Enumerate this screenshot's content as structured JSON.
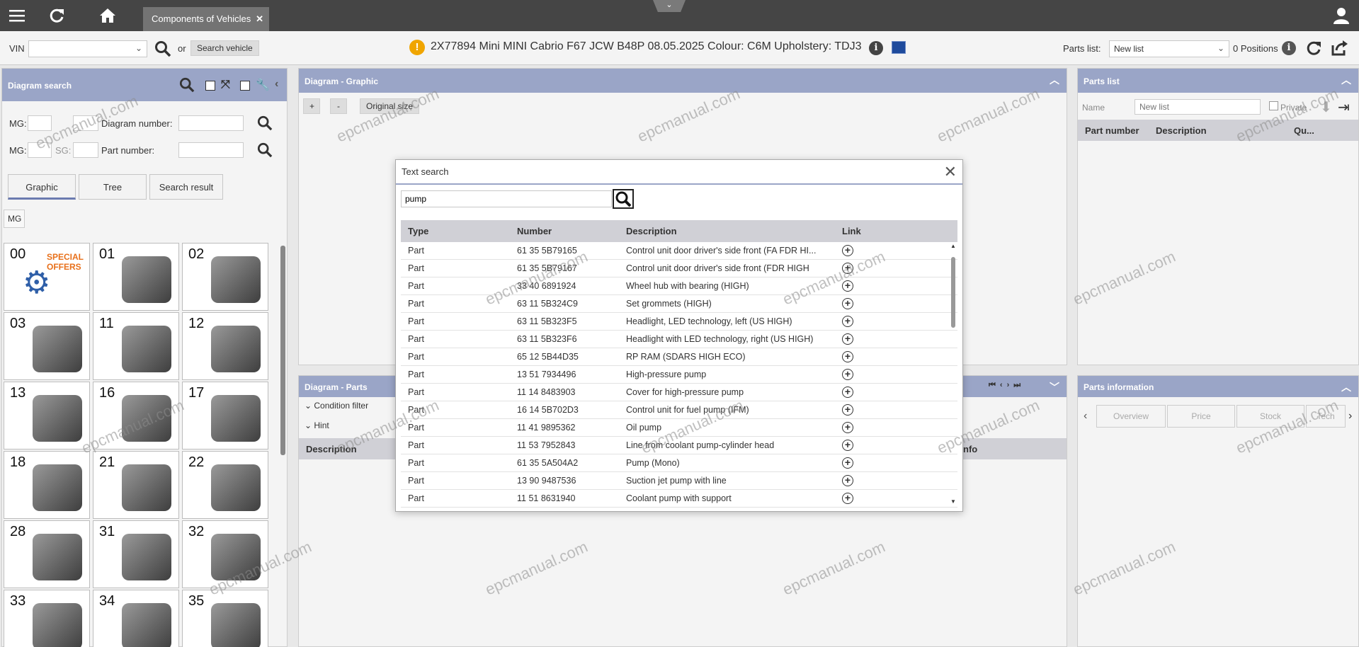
{
  "topbar": {
    "tab_label": "Components of Vehicles"
  },
  "vehicle_bar": {
    "vin_label": "VIN",
    "or_label": "or",
    "search_vehicle_label": "Search vehicle",
    "vehicle_info": "2X77894 Mini MINI Cabrio F67 JCW B48P 08.05.2025 Colour: C6M Upholstery: TDJ3",
    "parts_list_label": "Parts list:",
    "parts_list_value": "New list",
    "positions": "0 Positions"
  },
  "diagram_search": {
    "title": "Diagram search",
    "mg_label": "MG:",
    "sg_label": "SG:",
    "diagram_number_label": "Diagram number:",
    "part_number_label": "Part number:",
    "btn_graphic": "Graphic",
    "btn_tree": "Tree",
    "btn_search_result": "Search result",
    "mg_tab": "MG",
    "special_offers": "SPECIAL OFFERS",
    "tiles": [
      "00",
      "01",
      "02",
      "03",
      "11",
      "12",
      "13",
      "16",
      "17",
      "18",
      "21",
      "22",
      "28",
      "31",
      "32",
      "33",
      "34",
      "35"
    ]
  },
  "diagram_graphic": {
    "title": "Diagram - Graphic",
    "plus": "+",
    "minus": "-",
    "original_size": "Original size"
  },
  "diagram_parts": {
    "title": "Diagram - Parts",
    "condition_filter": "Condition filter",
    "hint": "Hint",
    "col_description": "Description",
    "col_info": "nfo"
  },
  "parts_list_panel": {
    "title": "Parts list",
    "name_label": "Name",
    "name_placeholder": "New list",
    "private_label": "Private",
    "col_part_number": "Part number",
    "col_description": "Description",
    "col_qty": "Qu..."
  },
  "parts_information": {
    "title": "Parts information",
    "tabs": [
      "Overview",
      "Price",
      "Stock",
      "Tech"
    ]
  },
  "text_search": {
    "title": "Text search",
    "query": "pump",
    "columns": [
      "Type",
      "Number",
      "Description",
      "Link"
    ],
    "rows": [
      {
        "type": "Part",
        "number": "61 35 5B79165",
        "description": "Control unit door driver's side front (FA FDR HI..."
      },
      {
        "type": "Part",
        "number": "61 35 5B79167",
        "description": "Control unit door driver's side front (FDR HIGH"
      },
      {
        "type": "Part",
        "number": "33 40 6891924",
        "description": "Wheel hub with bearing (HIGH)"
      },
      {
        "type": "Part",
        "number": "63 11 5B324C9",
        "description": "Set grommets (HIGH)"
      },
      {
        "type": "Part",
        "number": "63 11 5B323F5",
        "description": "Headlight, LED technology, left (US HIGH)"
      },
      {
        "type": "Part",
        "number": "63 11 5B323F6",
        "description": "Headlight with LED technology, right (US HIGH)"
      },
      {
        "type": "Part",
        "number": "65 12 5B44D35",
        "description": "RP RAM (SDARS HIGH ECO)"
      },
      {
        "type": "Part",
        "number": "13 51 7934496",
        "description": "High-pressure pump"
      },
      {
        "type": "Part",
        "number": "11 14 8483903",
        "description": "Cover for high-pressure pump"
      },
      {
        "type": "Part",
        "number": "16 14 5B702D3",
        "description": "Control unit for fuel pump (IFM)"
      },
      {
        "type": "Part",
        "number": "11 41 9895362",
        "description": "Oil pump"
      },
      {
        "type": "Part",
        "number": "11 53 7952843",
        "description": "Line from coolant pump-cylinder head"
      },
      {
        "type": "Part",
        "number": "61 35 5A504A2",
        "description": "Pump (Mono)"
      },
      {
        "type": "Part",
        "number": "13 90 9487536",
        "description": "Suction jet pump with line"
      },
      {
        "type": "Part",
        "number": "11 51 8631940",
        "description": "Coolant pump with support"
      }
    ]
  },
  "watermark": "epcmanual.com"
}
